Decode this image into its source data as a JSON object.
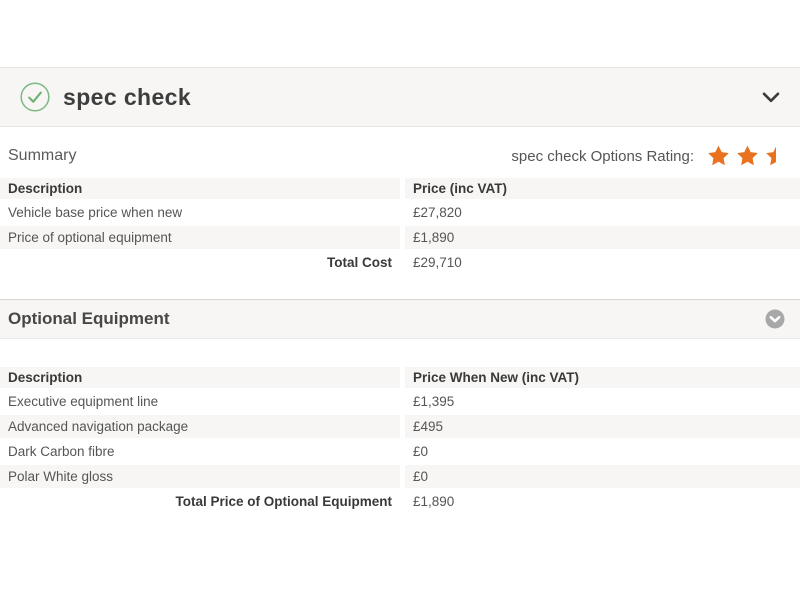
{
  "panel": {
    "title": "spec check"
  },
  "summary": {
    "label": "Summary",
    "rating_label": "spec check Options Rating:",
    "stars": [
      "full",
      "full",
      "half"
    ]
  },
  "summary_table": {
    "col_description": "Description",
    "col_price": "Price (inc VAT)",
    "rows": [
      {
        "description": "Vehicle base price when new",
        "price": "£27,820"
      },
      {
        "description": "Price of optional equipment",
        "price": "£1,890"
      }
    ],
    "total_label": "Total Cost",
    "total_price": "£29,710"
  },
  "optional_equipment": {
    "title": "Optional Equipment",
    "col_description": "Description",
    "col_price": "Price When New (inc VAT)",
    "rows": [
      {
        "description": "Executive equipment line",
        "price": "£1,395"
      },
      {
        "description": "Advanced navigation package",
        "price": "£495"
      },
      {
        "description": "Dark Carbon fibre",
        "price": "£0"
      },
      {
        "description": "Polar White gloss",
        "price": "£0"
      }
    ],
    "total_label": "Total Price of Optional Equipment",
    "total_price": "£1,890"
  },
  "icons": {
    "header_status": "check-circle",
    "header_collapse": "chevron-down",
    "section_collapse": "chevron-down-circle",
    "rating": "star"
  },
  "colors": {
    "star_orange": "#e8721f",
    "check_green_ring": "#7bb981",
    "check_green_mark": "#6db173",
    "bar_bg": "#f7f6f4",
    "row_alt_bg": "#f7f6f4",
    "border": "#e7e5e2",
    "text_dark": "#393939",
    "text_body": "#555555",
    "circle_icon_gray": "#a8a8a8",
    "chevron_dark": "#3b3b3b"
  }
}
